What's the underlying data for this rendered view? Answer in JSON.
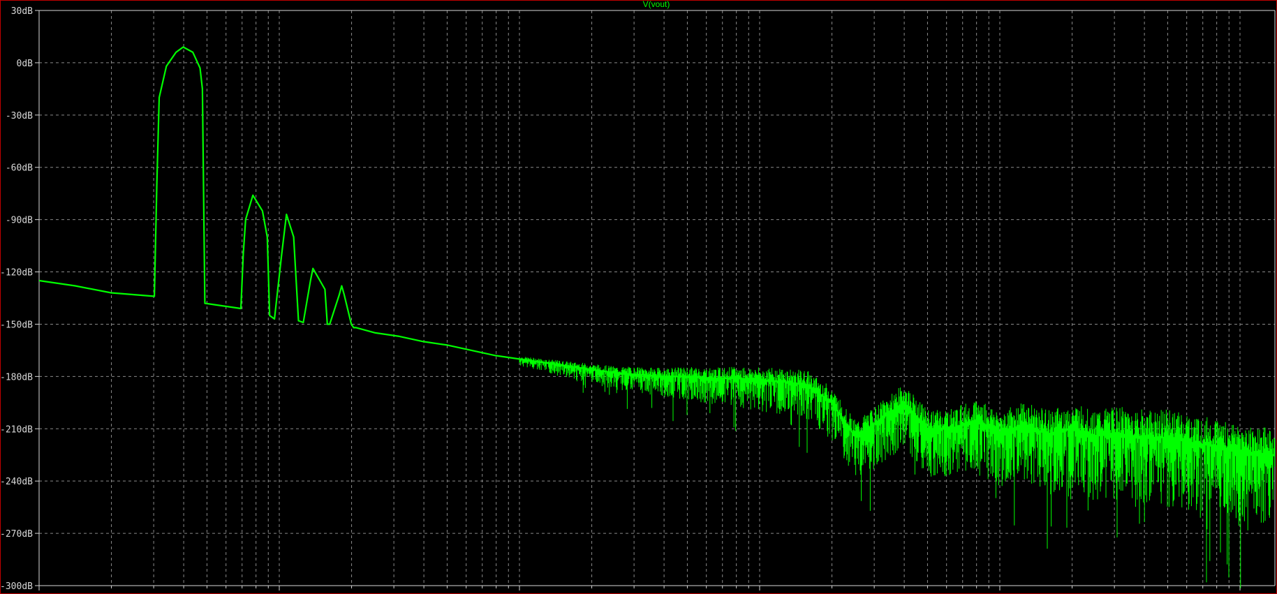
{
  "chart_data": {
    "type": "line",
    "title": "V(vout)",
    "trace_color": "#00ff00",
    "y_unit": "dB",
    "ylim": [
      -300,
      30
    ],
    "y_ticks": [
      30,
      0,
      -30,
      -60,
      -90,
      -120,
      -150,
      -180,
      -210,
      -240,
      -270,
      -300
    ],
    "y_tick_labels": [
      "30dB",
      "0dB",
      "-30dB",
      "-60dB",
      "-90dB",
      "-120dB",
      "-150dB",
      "-180dB",
      "-210dB",
      "-240dB",
      "-270dB",
      "-300dB"
    ],
    "x_scale": "log",
    "x_decades": 5.14,
    "grid": true,
    "series": [
      {
        "values_note": "",
        "x": [
          0.0,
          0.15,
          0.3,
          0.48,
          0.49,
          0.5,
          0.53,
          0.57,
          0.6,
          0.64,
          0.67,
          0.68,
          0.69,
          0.84,
          0.85,
          0.86,
          0.89,
          0.93,
          0.95,
          0.96,
          0.97,
          0.98,
          1.01,
          1.03,
          1.06,
          1.08,
          1.1,
          1.13,
          1.14,
          1.19,
          1.2,
          1.21,
          1.25,
          1.26,
          1.27,
          1.3,
          1.31,
          1.32,
          1.4,
          1.5,
          1.6,
          1.7,
          1.8,
          1.9,
          2.0,
          2.1,
          2.2,
          2.3,
          2.4,
          2.5,
          2.6,
          2.7,
          2.8,
          2.9,
          3.0,
          3.1,
          3.2,
          3.3,
          3.4,
          3.5,
          3.6,
          3.7,
          3.8,
          3.9,
          4.0,
          4.1,
          4.2,
          4.3,
          4.4,
          4.5,
          4.6,
          4.7,
          4.8,
          4.9,
          5.0,
          5.14
        ],
        "y": [
          -125,
          -128,
          -132,
          -134,
          -70,
          -20,
          -2,
          6,
          9,
          6,
          -3,
          -15,
          -138,
          -141,
          -110,
          -90,
          -76,
          -85,
          -100,
          -145,
          -146,
          -147,
          -110,
          -87,
          -100,
          -148,
          -149,
          -125,
          -118,
          -130,
          -150,
          -150,
          -133,
          -128,
          -133,
          -150,
          -152,
          -152,
          -155,
          -157,
          -160,
          -162,
          -165,
          -168,
          -170,
          -172,
          -174,
          -176,
          -178,
          -179,
          -180,
          -180,
          -181,
          -181,
          -182,
          -183,
          -185,
          -195,
          -215,
          -205,
          -195,
          -210,
          -210,
          -205,
          -212,
          -208,
          -213,
          -210,
          -214,
          -213,
          -215,
          -215,
          -218,
          -220,
          -223,
          -225
        ]
      }
    ]
  }
}
